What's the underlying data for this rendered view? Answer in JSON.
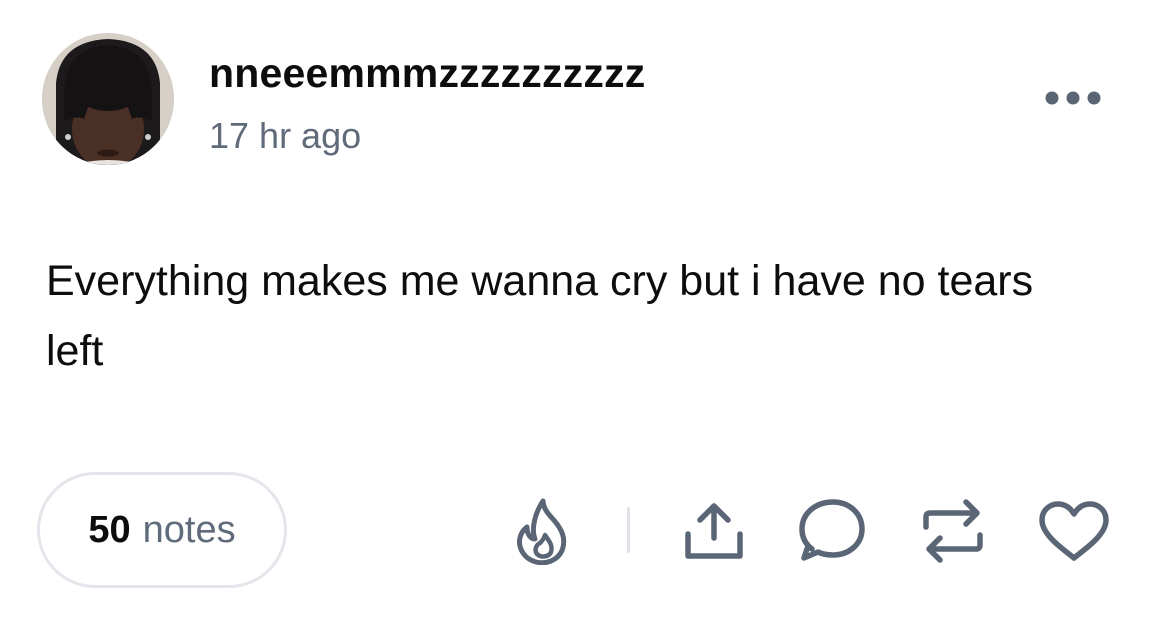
{
  "post": {
    "author": {
      "username": "nneeemmmzzzzzzzzzz",
      "avatar_icon": "user-avatar-photo"
    },
    "timestamp": "17 hr ago",
    "body": "Everything makes me wanna cry but i have no tears left",
    "notes": {
      "count": "50",
      "label": "notes"
    },
    "actions": [
      {
        "name": "blaze",
        "icon": "flame-icon"
      },
      {
        "name": "share",
        "icon": "share-icon"
      },
      {
        "name": "reply",
        "icon": "comment-icon"
      },
      {
        "name": "reblog",
        "icon": "reblog-icon"
      },
      {
        "name": "like",
        "icon": "heart-icon"
      }
    ],
    "more_icon": "more-options-icon"
  },
  "colors": {
    "text_primary": "#0d0d0d",
    "text_secondary": "#5f6b7a",
    "icon_gray": "#5a6675",
    "border": "#e3e6ea"
  }
}
